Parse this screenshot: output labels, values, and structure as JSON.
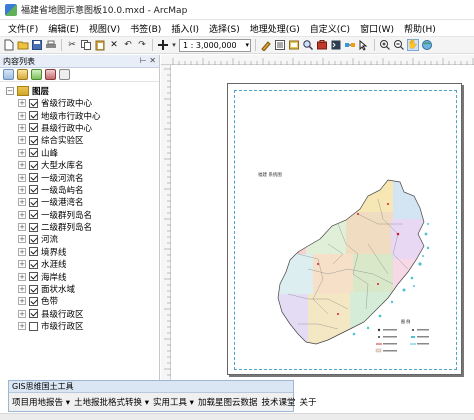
{
  "window": {
    "title": "福建省地图示意图板10.0.mxd - ArcMap"
  },
  "menu": [
    "文件(F)",
    "编辑(E)",
    "视图(V)",
    "书签(B)",
    "插入(I)",
    "选择(S)",
    "地理处理(G)",
    "自定义(C)",
    "窗口(W)",
    "帮助(H)"
  ],
  "toolbar": {
    "scale": "1 : 3,000,000"
  },
  "toc": {
    "title": "内容列表",
    "root": "图层",
    "layers": [
      {
        "name": "省级行政中心",
        "checked": true
      },
      {
        "name": "地级市行政中心",
        "checked": true
      },
      {
        "name": "县级行政中心",
        "checked": true
      },
      {
        "name": "综合实验区",
        "checked": true
      },
      {
        "name": "山峰",
        "checked": true
      },
      {
        "name": "大型水库名",
        "checked": true
      },
      {
        "name": "一级河流名",
        "checked": true
      },
      {
        "name": "一级岛屿名",
        "checked": true
      },
      {
        "name": "一级港湾名",
        "checked": true
      },
      {
        "name": "一级群列岛名",
        "checked": true
      },
      {
        "name": "二级群列岛名",
        "checked": true
      },
      {
        "name": "河流",
        "checked": true
      },
      {
        "name": "境界线",
        "checked": true
      },
      {
        "name": "水涯线",
        "checked": true
      },
      {
        "name": "海岸线",
        "checked": true
      },
      {
        "name": "面状水域",
        "checked": true
      },
      {
        "name": "色带",
        "checked": true
      },
      {
        "name": "县级行政区",
        "checked": true
      },
      {
        "name": "市级行政区",
        "checked": false
      }
    ]
  },
  "map": {
    "title": "福建 系统图",
    "legend_title": "图 例"
  },
  "gis_toolbar": {
    "title": "GIS思维国土工具",
    "items": [
      "项目用地报告",
      "土地报批格式转换",
      "实用工具",
      "加载星图云数据",
      "技术课堂",
      "关于"
    ]
  }
}
